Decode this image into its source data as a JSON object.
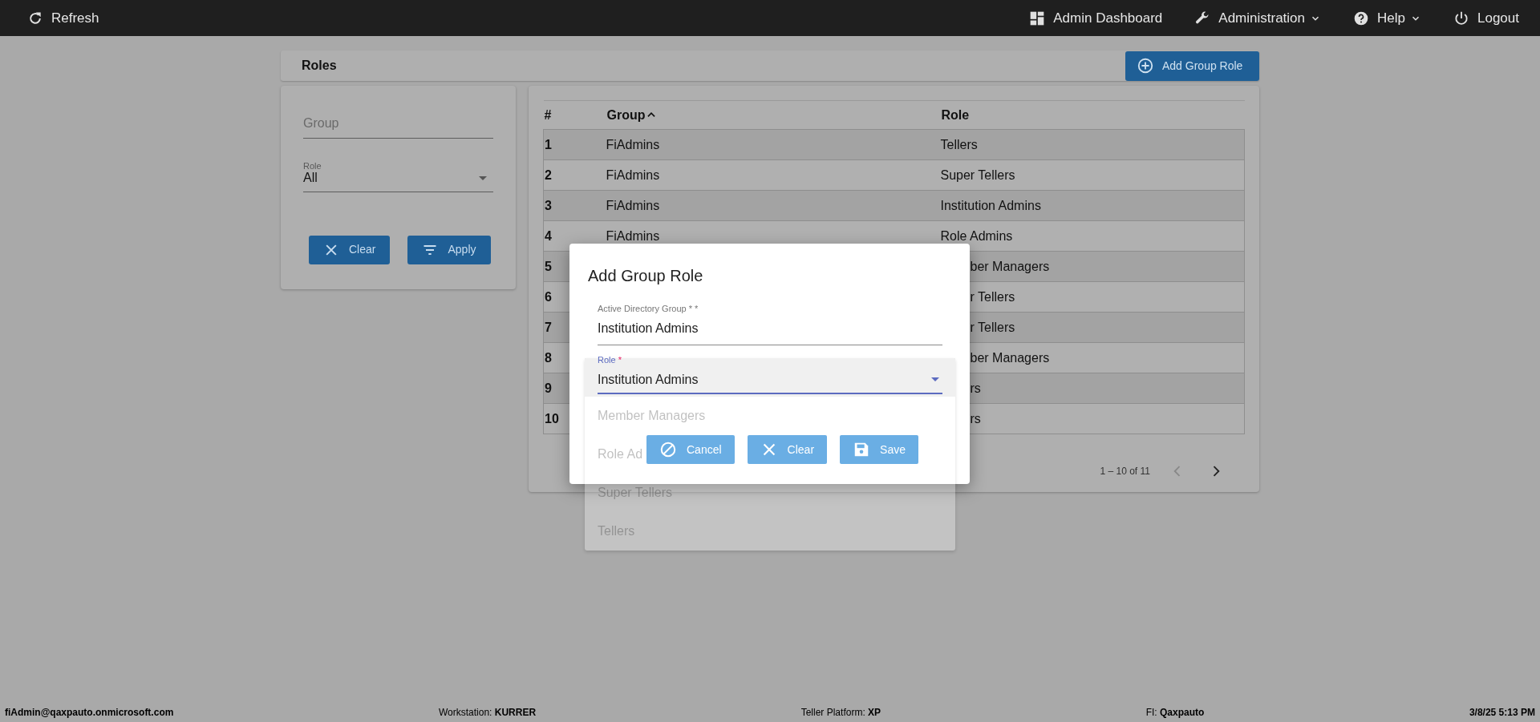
{
  "navbar": {
    "left": [
      {
        "label": "Refresh",
        "caret": false
      }
    ],
    "right": [
      {
        "label": "Admin Dashboard",
        "caret": false
      },
      {
        "label": "Administration",
        "caret": true
      },
      {
        "label": "Help",
        "caret": true
      },
      {
        "label": "Logout",
        "caret": false
      }
    ]
  },
  "page_title": "Roles",
  "add_button": {
    "label": "Add Group Role"
  },
  "filter": {
    "group": {
      "placeholder": "Group"
    },
    "role": {
      "label": "Role",
      "value": "All"
    },
    "buttons": [
      {
        "label": "Clear"
      },
      {
        "label": "Apply"
      }
    ]
  },
  "table": {
    "columns": [
      {
        "label": "#",
        "sorted": false
      },
      {
        "label": "Group",
        "sorted": true
      },
      {
        "label": "Role",
        "sorted": false
      }
    ],
    "rows": [
      {
        "number": "1",
        "group": "FiAdmins",
        "role": "Tellers",
        "partial": false
      },
      {
        "number": "2",
        "group": "FiAdmins",
        "role": "Super Tellers",
        "partial": false
      },
      {
        "number": "3",
        "group": "FiAdmins",
        "role": "Institution Admins",
        "partial": false
      },
      {
        "number": "4",
        "group": "FiAdmins",
        "role": "Role Admins",
        "partial": false
      },
      {
        "number": "5",
        "role": "ber Managers",
        "partial": true
      },
      {
        "number": "6",
        "role": "r Tellers",
        "partial": true
      },
      {
        "number": "7",
        "role": "r Tellers",
        "partial": true
      },
      {
        "number": "8",
        "role": "ber Managers",
        "partial": true
      },
      {
        "number": "9",
        "role": "rs",
        "partial": true
      },
      {
        "number": "10",
        "role": "rs",
        "partial": true
      }
    ]
  },
  "pagination": {
    "range": "1 – 10 of 11",
    "prev_disabled": true,
    "next_disabled": false
  },
  "dialog": {
    "title": "Add Group Role",
    "fields": [
      {
        "label": "Active Directory Group * *",
        "value": "Institution Admins",
        "focused": false,
        "kind": "text"
      },
      {
        "label": "Role",
        "required_mark": "*",
        "value": "Institution Admins",
        "focused": true,
        "kind": "select"
      }
    ],
    "buttons": [
      {
        "label": "Cancel"
      },
      {
        "label": "Clear"
      },
      {
        "label": "Save"
      }
    ]
  },
  "dropdown": {
    "options": [
      "Member Managers",
      "Role Ad",
      "Super Tellers",
      "Tellers"
    ]
  },
  "status_bar": [
    {
      "text": "fiAdmin@qaxpauto.onmicrosoft.com",
      "bold": true
    },
    {
      "text": "Workstation: **KURRER**",
      "bold": false
    },
    {
      "text": "Teller Platform: **XP**",
      "bold": false
    },
    {
      "text": "FI: **Qaxpauto**",
      "bold": false
    },
    {
      "text": "3/8/25 5:13 PM",
      "bold": true
    }
  ]
}
